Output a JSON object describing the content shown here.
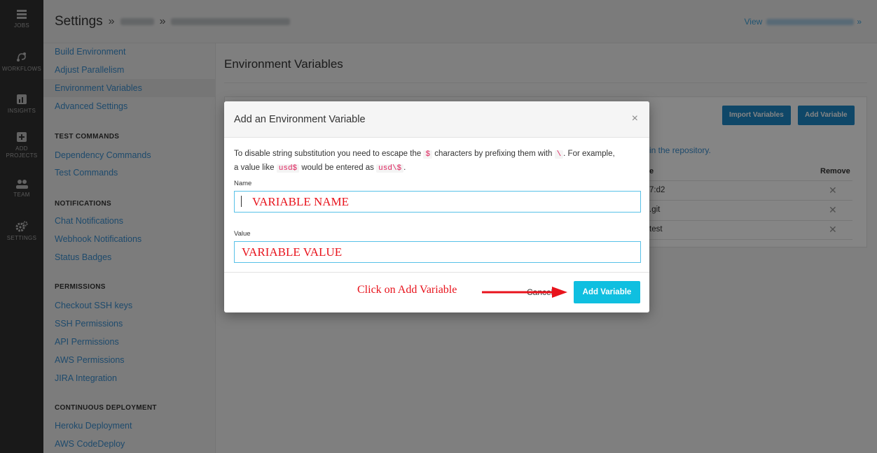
{
  "sidebar": {
    "items": [
      {
        "label": "JOBS",
        "icon": "jobs-icon"
      },
      {
        "label": "WORKFLOWS",
        "icon": "workflows-icon"
      },
      {
        "label": "INSIGHTS",
        "icon": "insights-icon"
      },
      {
        "label": "ADD PROJECTS",
        "icon": "add-projects-icon"
      },
      {
        "label": "TEAM",
        "icon": "team-icon"
      },
      {
        "label": "SETTINGS",
        "icon": "settings-icon"
      }
    ]
  },
  "header": {
    "title": "Settings",
    "separator": "»",
    "view_label": "View",
    "view_suffix": "»"
  },
  "settings_nav": {
    "links_top": [
      "Build Environment",
      "Adjust Parallelism",
      "Environment Variables",
      "Advanced Settings"
    ],
    "active": "Environment Variables",
    "sections": [
      {
        "heading": "TEST COMMANDS",
        "links": [
          "Dependency Commands",
          "Test Commands"
        ]
      },
      {
        "heading": "NOTIFICATIONS",
        "links": [
          "Chat Notifications",
          "Webhook Notifications",
          "Status Badges"
        ]
      },
      {
        "heading": "PERMISSIONS",
        "links": [
          "Checkout SSH keys",
          "SSH Permissions",
          "API Permissions",
          "AWS Permissions",
          "JIRA Integration"
        ]
      },
      {
        "heading": "CONTINUOUS DEPLOYMENT",
        "links": [
          "Heroku Deployment",
          "AWS CodeDeploy"
        ]
      }
    ]
  },
  "main": {
    "page_title": "Environment Variables",
    "import_button": "Import Variables",
    "add_button": "Add Variable",
    "repo_note": "in the repository.",
    "column_value_fragment": "e",
    "column_remove": "Remove",
    "rows": [
      {
        "value": "7:d2",
        "remove": "✕"
      },
      {
        "value": ".git",
        "remove": "✕"
      },
      {
        "value": "test",
        "remove": "✕"
      }
    ]
  },
  "modal": {
    "title": "Add an Environment Variable",
    "close": "×",
    "desc_1": "To disable string substitution you need to escape the",
    "desc_code_1": "$",
    "desc_2": "characters by prefixing them with",
    "desc_code_2": "\\",
    "desc_3": ". For example,",
    "desc_4": "a value like",
    "desc_code_3": "usd$",
    "desc_5": "would be entered as",
    "desc_code_4": "usd\\$",
    "desc_6": ".",
    "name_label": "Name",
    "name_value": "VARIABLE NAME",
    "value_label": "Value",
    "value_value": "VARIABLE VALUE",
    "annotation": "Click on Add Variable",
    "cancel_label": "Cancel",
    "submit_label": "Add Variable"
  },
  "colors": {
    "accent": "#0fbfe0",
    "link": "#3a8fd0",
    "annotation": "#e8131c"
  }
}
